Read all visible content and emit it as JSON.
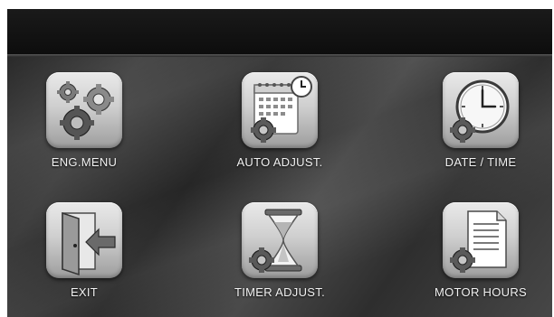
{
  "header": {
    "title": ""
  },
  "menu": {
    "items": [
      {
        "label": "ENG.MENU",
        "icon": "gears-icon"
      },
      {
        "label": "AUTO ADJUST.",
        "icon": "calendar-clock-icon"
      },
      {
        "label": "DATE / TIME",
        "icon": "clock-icon"
      },
      {
        "label": "EXIT",
        "icon": "exit-door-icon"
      },
      {
        "label": "TIMER ADJUST.",
        "icon": "hourglass-icon"
      },
      {
        "label": "MOTOR HOURS",
        "icon": "document-icon"
      }
    ]
  }
}
